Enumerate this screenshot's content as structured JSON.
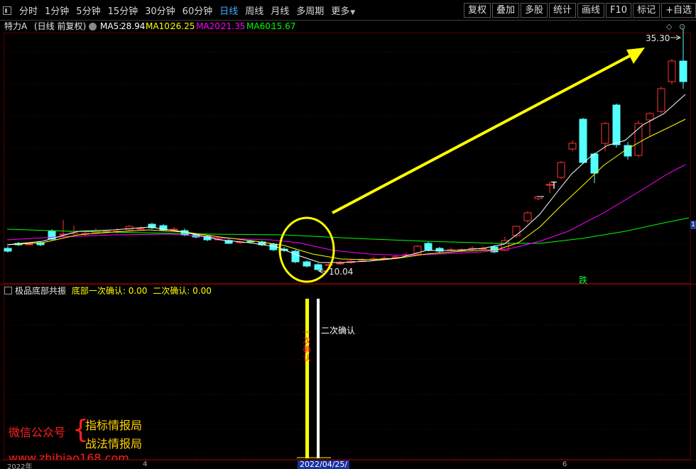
{
  "toolbar": {
    "periods": [
      "分时",
      "1分钟",
      "5分钟",
      "15分钟",
      "30分钟",
      "60分钟",
      "日线",
      "周线",
      "月线",
      "多周期",
      "更多"
    ],
    "active_period": "日线",
    "tools": [
      "复权",
      "叠加",
      "多股",
      "统计",
      "画线",
      "F10",
      "标记",
      "+自选"
    ]
  },
  "header": {
    "stock_name": "特力A",
    "mode": "(日线 前复权)",
    "ma5_label": "MA5:",
    "ma5": "28.94",
    "ma10_label": "MA10:",
    "ma10": "26.25",
    "ma20_label": "MA20:",
    "ma20": "21.35",
    "ma60_label": "MA60:",
    "ma60": "15.67"
  },
  "colors": {
    "up": "#ff3232",
    "down": "#54ffff",
    "ma5": "#ffffff",
    "ma10": "#ffff00",
    "ma20": "#ff00ff",
    "ma60": "#00ff00",
    "arrow": "#ffff00",
    "circle": "#ffff00"
  },
  "indicator": {
    "name": "极品底部共振",
    "line1_label": "底部一次确认:",
    "line1_value": "0.00",
    "line2_label": "二次确认:",
    "line2_value": "0.00",
    "first_signal_text": "一次确认",
    "second_signal_text": "二次确认"
  },
  "chart_data": {
    "type": "candlestick",
    "high_label": "35.30",
    "low_label": "10.04",
    "events": [
      "跌"
    ],
    "ma": {
      "MA5": 28.94,
      "MA10": 26.25,
      "MA20": 21.35,
      "MA60": 15.67
    }
  },
  "watermark": {
    "line1": "微信公众号",
    "brace": "{",
    "line2": "指标情报局",
    "line3": "战法情报局",
    "line4": "www.zhibiao168.com"
  },
  "xaxis": {
    "labels": [
      "2022年",
      "4",
      "6"
    ],
    "cursor_date": "2022/04/25/"
  },
  "side_marker": "1"
}
